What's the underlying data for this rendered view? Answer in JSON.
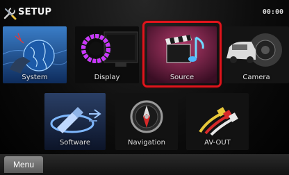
{
  "header": {
    "title": "SETUP",
    "clock": "00:00"
  },
  "tiles_top": [
    {
      "label": "System"
    },
    {
      "label": "Display"
    },
    {
      "label": "Source"
    },
    {
      "label": "Camera"
    }
  ],
  "tiles_bottom": [
    {
      "label": "Software"
    },
    {
      "label": "Navigation"
    },
    {
      "label": "AV-OUT"
    }
  ],
  "selected_tile": "Source",
  "highlight_color": "#e0141c",
  "footer": {
    "menu_label": "Menu"
  },
  "icons": {
    "header": "wrench-screwdriver-icon",
    "system": "globe-hand-icon",
    "display": "color-ring-monitor-icon",
    "source": "clapperboard-music-note-icon",
    "camera": "car-camera-icon",
    "software": "usb-arrow-icon",
    "navigation": "compass-icon",
    "av_out": "rca-cable-icon"
  }
}
